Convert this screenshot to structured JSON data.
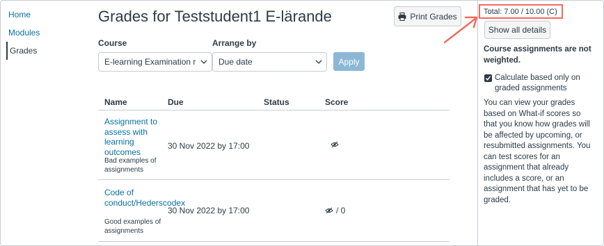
{
  "nav": {
    "items": [
      {
        "label": "Home"
      },
      {
        "label": "Modules"
      },
      {
        "label": "Grades"
      }
    ]
  },
  "header": {
    "title": "Grades for Teststudent1 E-lärande",
    "print_label": "Print Grades"
  },
  "filters": {
    "course_label": "Course",
    "course_value": "E-learning Examination room",
    "arrange_label": "Arrange by",
    "arrange_value": "Due date",
    "apply_label": "Apply"
  },
  "table": {
    "columns": [
      "Name",
      "Due",
      "Status",
      "Score"
    ],
    "rows": [
      {
        "name": "Assignment to assess with learning outcomes",
        "group": "Bad examples of assignments",
        "due": "30 Nov 2022 by 17:00",
        "status": "",
        "score": ""
      },
      {
        "name": "Code of conduct/Hederscodex",
        "group": "Good examples of assignments",
        "due": "30 Nov 2022 by 17:00",
        "status": "",
        "score": "/ 0"
      }
    ]
  },
  "sidebar": {
    "total": "Total: 7.00 / 10.00 (C)",
    "show_details_label": "Show all details",
    "weighted_note": "Course assignments are not weighted.",
    "checkbox_label": "Calculate based only on graded assignments",
    "checkbox_checked": true,
    "whatif_text": "You can view your grades based on What-if scores so that you know how grades will be affected by upcoming, or resubmitted assignments. You can test scores for an assignment that already includes a score, or an assignment that has yet to be graded."
  },
  "colors": {
    "link": "#0770a3",
    "text": "#2d3b45",
    "apply_button": "#8cb8d6",
    "annotation": "#f46a5c"
  }
}
